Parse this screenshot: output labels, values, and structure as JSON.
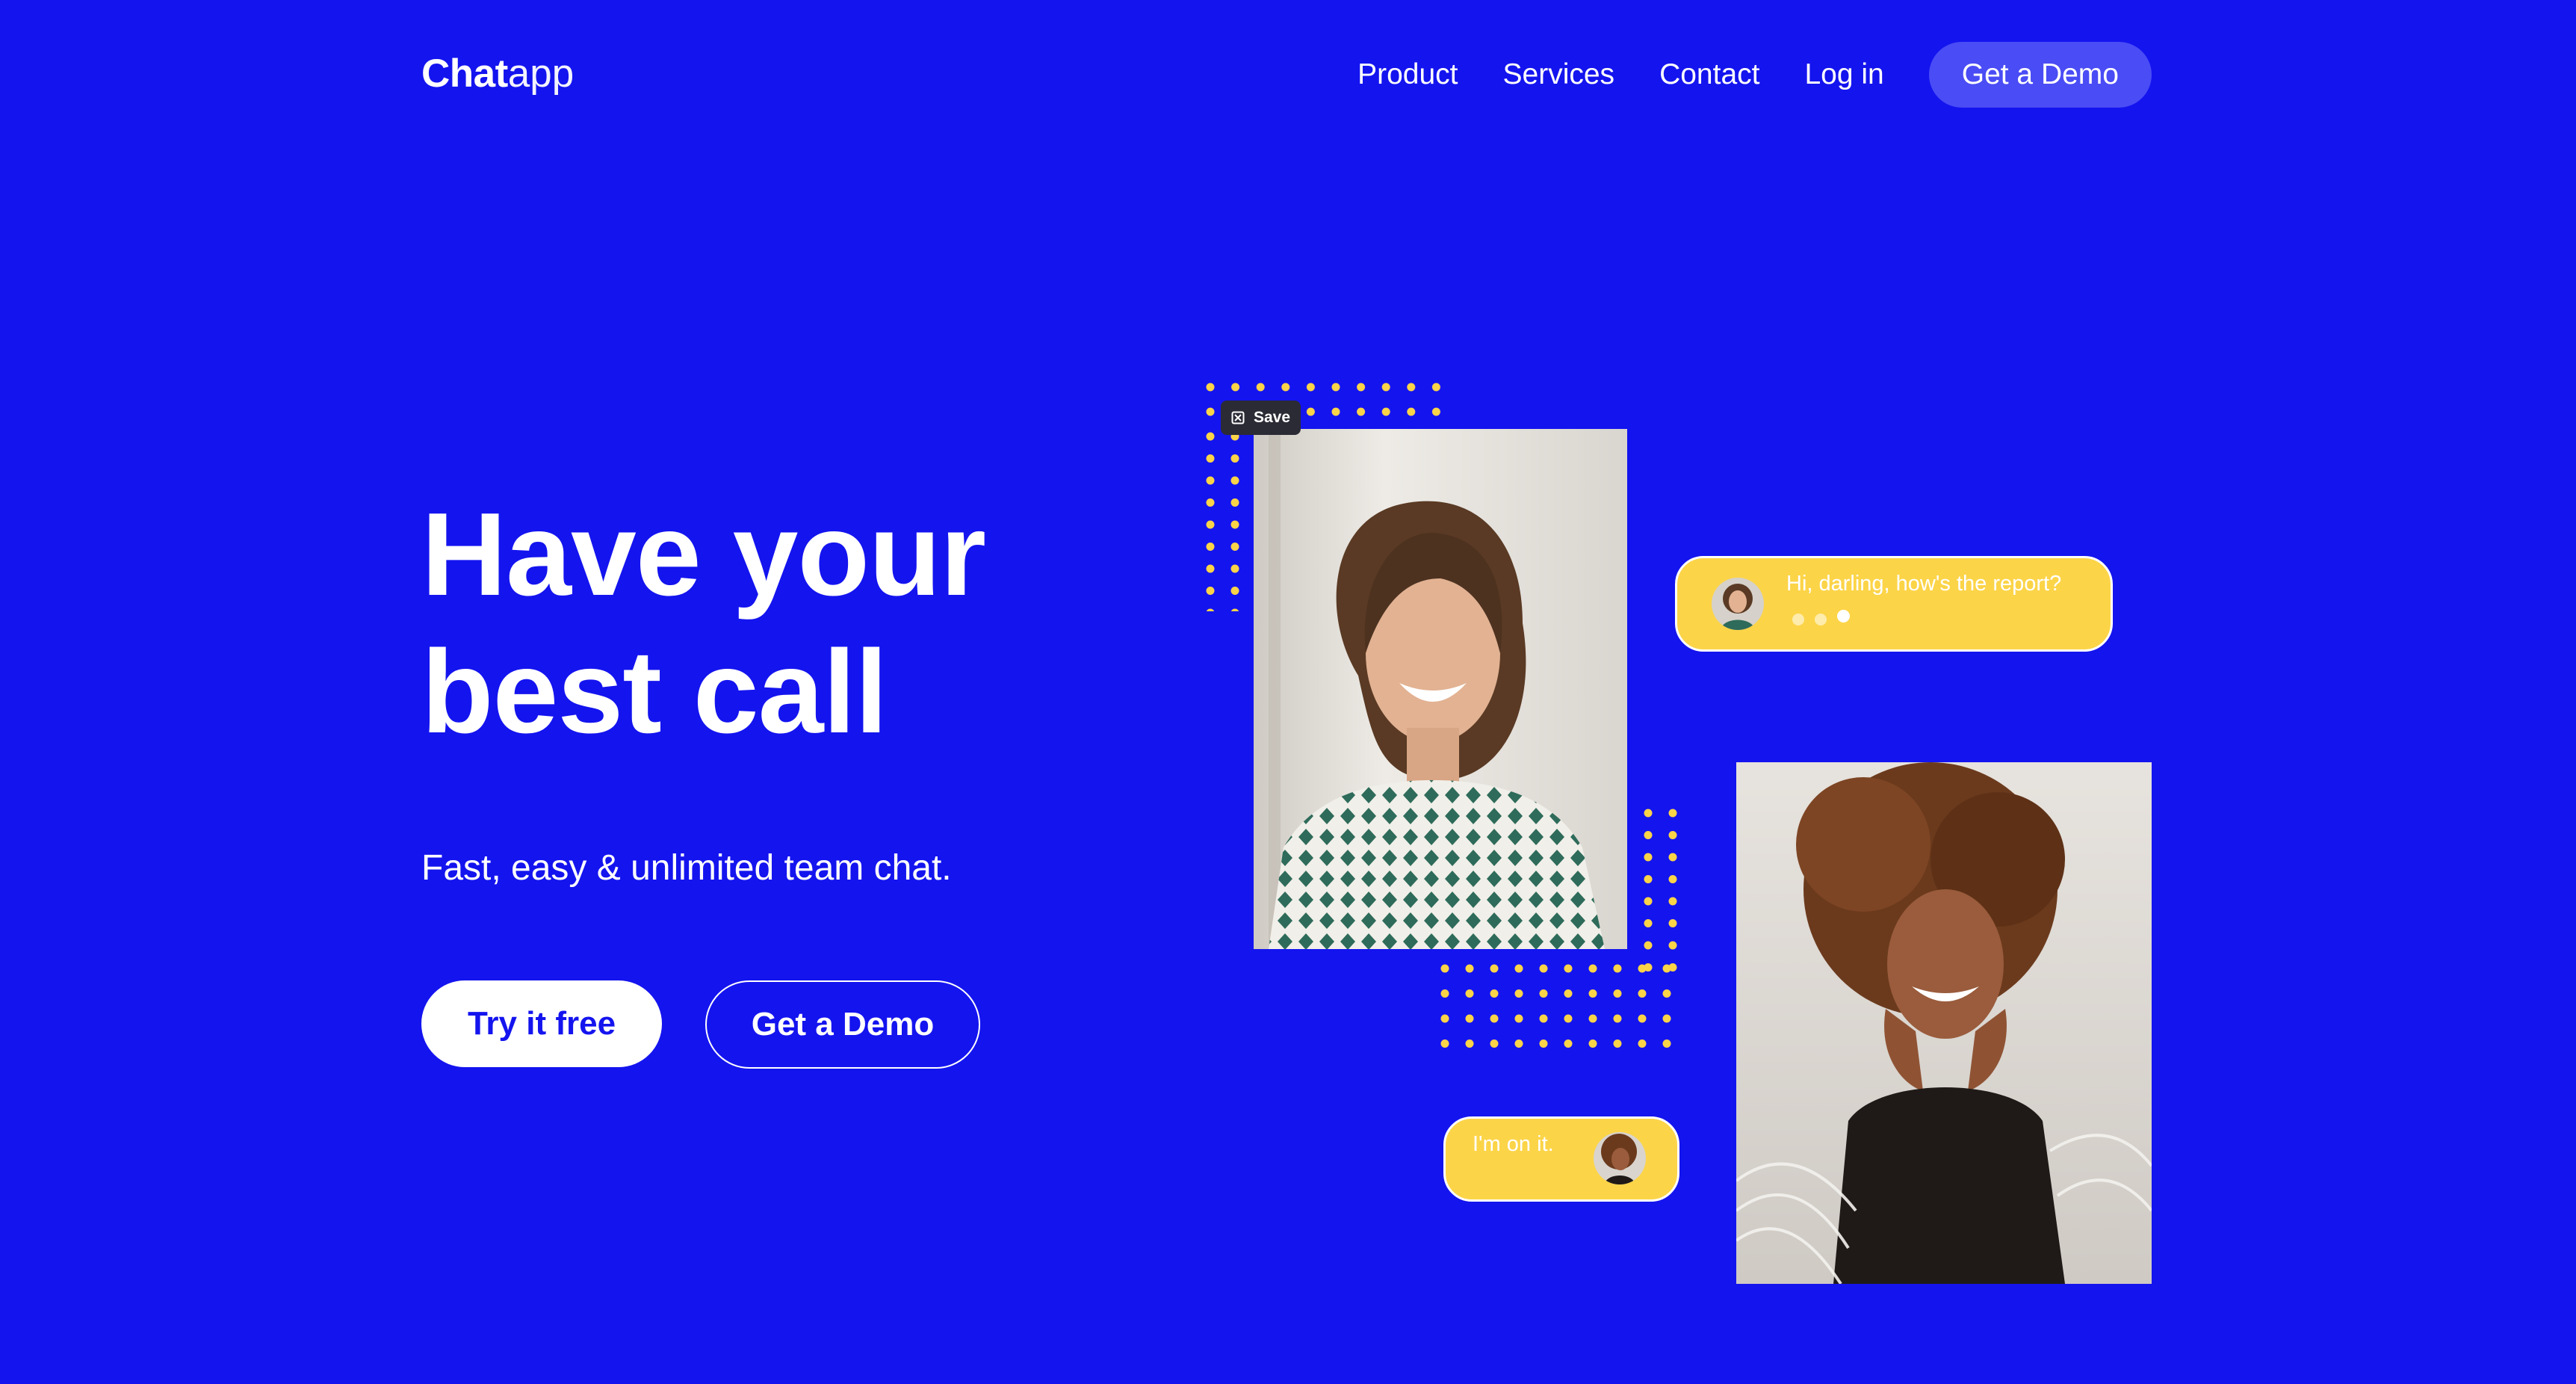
{
  "colors": {
    "background": "#1414ef",
    "accent_yellow": "#fcd448",
    "nav_button": "#4a4cf5",
    "white": "#ffffff"
  },
  "nav": {
    "logo_bold": "Chat",
    "logo_light": "app",
    "links": [
      "Product",
      "Services",
      "Contact",
      "Log in"
    ],
    "cta": "Get a Demo"
  },
  "hero": {
    "headline_line1": "Have your",
    "headline_line2": "best call",
    "subtitle": "Fast, easy & unlimited team chat.",
    "primary_button": "Try it free",
    "secondary_button": "Get a Demo"
  },
  "visual": {
    "save_badge": "Save",
    "save_icon": "pin-icon",
    "bubble_1_text": "Hi, darling, how's the report?",
    "bubble_2_text": "I'm on it."
  }
}
